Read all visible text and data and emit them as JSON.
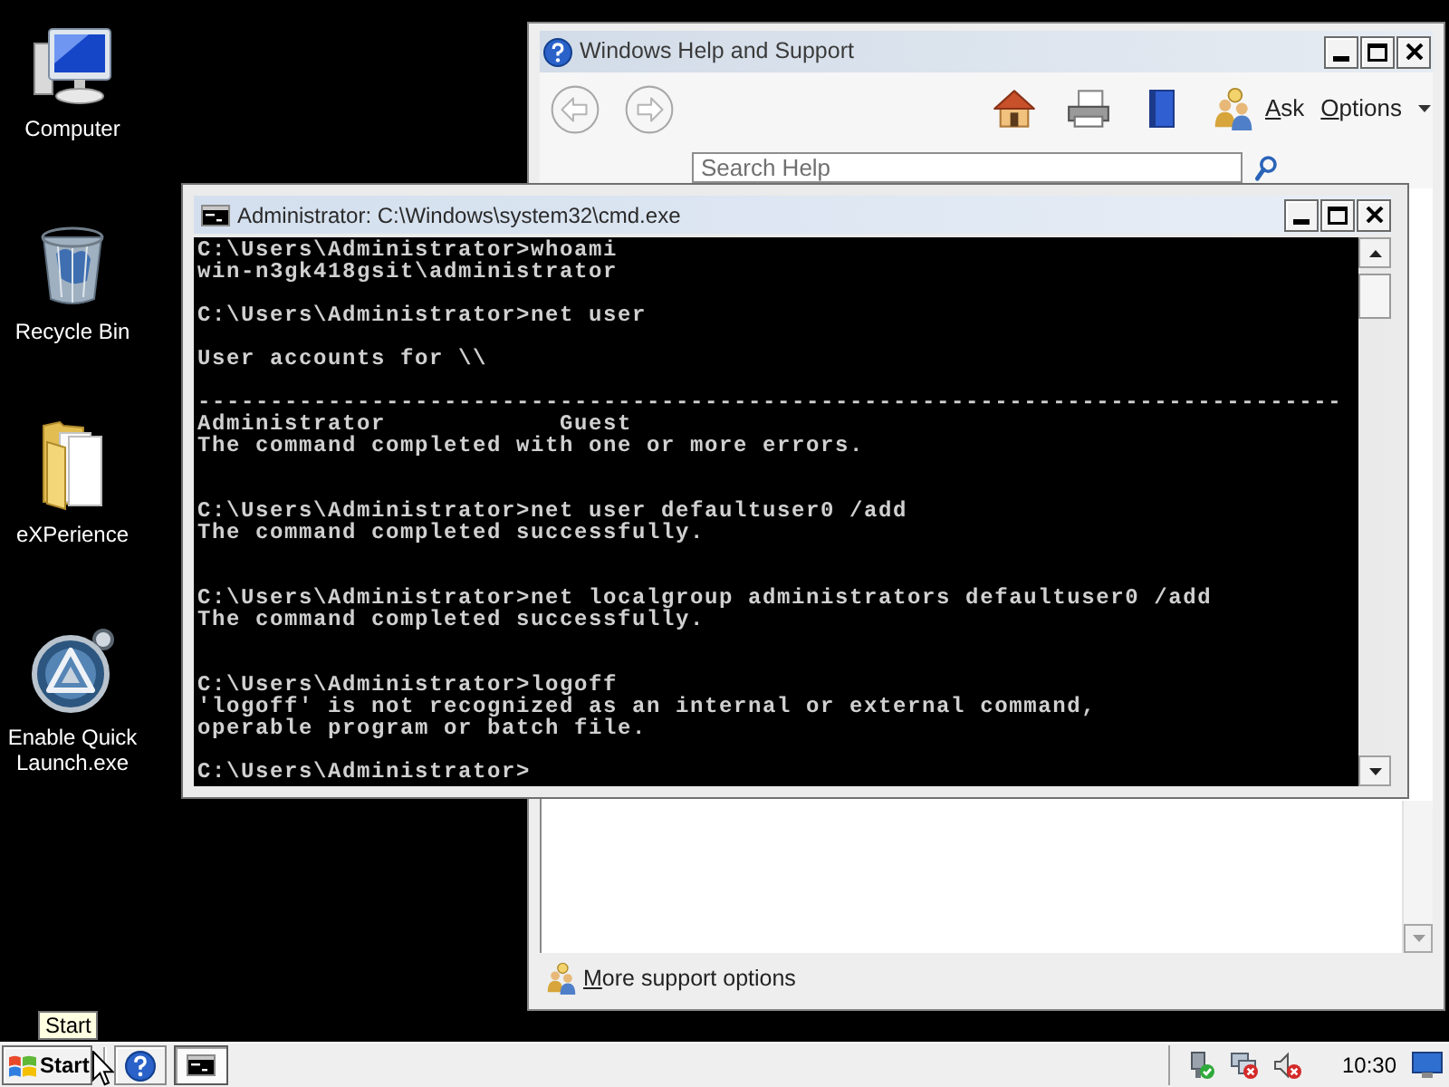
{
  "desktop": {
    "icons": [
      {
        "kind": "computer",
        "label": "Computer"
      },
      {
        "kind": "bin",
        "label": "Recycle Bin"
      },
      {
        "kind": "folder",
        "label": "eXPerience"
      },
      {
        "kind": "program",
        "label": "Enable Quick Launch.exe"
      }
    ]
  },
  "help_window": {
    "title": "Windows Help and Support",
    "toolbar": {
      "back": {
        "disabled": true
      },
      "forward": {
        "disabled": true
      },
      "ask": {
        "label": "Ask",
        "access_key": true
      },
      "options": {
        "label": "Options",
        "access_key": true
      }
    },
    "search": {
      "placeholder": "Search Help"
    },
    "footer_link": {
      "label": "More support options",
      "access_key": true
    }
  },
  "cmd_window": {
    "title": "Administrator: C:\\Windows\\system32\\cmd.exe",
    "lines": [
      {
        "kind": "text",
        "text": "C:\\Users\\Administrator>whoami"
      },
      {
        "kind": "text",
        "text": "win-n3gk418gsit\\administrator"
      },
      {
        "kind": "blank"
      },
      {
        "kind": "text",
        "text": "C:\\Users\\Administrator>net user"
      },
      {
        "kind": "blank"
      },
      {
        "kind": "text",
        "text": "User accounts for \\\\"
      },
      {
        "kind": "blank"
      },
      {
        "kind": "text",
        "text": "-------------------------------------------------------------------------------"
      },
      {
        "kind": "text",
        "text": "Administrator            Guest"
      },
      {
        "kind": "text",
        "text": "The command completed with one or more errors."
      },
      {
        "kind": "blank"
      },
      {
        "kind": "blank"
      },
      {
        "kind": "text",
        "text": "C:\\Users\\Administrator>net user defaultuser0 /add"
      },
      {
        "kind": "text",
        "text": "The command completed successfully."
      },
      {
        "kind": "blank"
      },
      {
        "kind": "blank"
      },
      {
        "kind": "text",
        "text": "C:\\Users\\Administrator>net localgroup administrators defaultuser0 /add"
      },
      {
        "kind": "text",
        "text": "The command completed successfully."
      },
      {
        "kind": "blank"
      },
      {
        "kind": "blank"
      },
      {
        "kind": "text",
        "text": "C:\\Users\\Administrator>logoff"
      },
      {
        "kind": "text",
        "text": "'logoff' is not recognized as an internal or external command,"
      },
      {
        "kind": "text",
        "text": "operable program or batch file."
      },
      {
        "kind": "blank"
      },
      {
        "kind": "text",
        "text": "C:\\Users\\Administrator>"
      }
    ]
  },
  "taskbar": {
    "tooltip": "Start",
    "start_button": "Start",
    "task_buttons": [
      {
        "selected": true
      }
    ],
    "clock": "10:30"
  }
}
